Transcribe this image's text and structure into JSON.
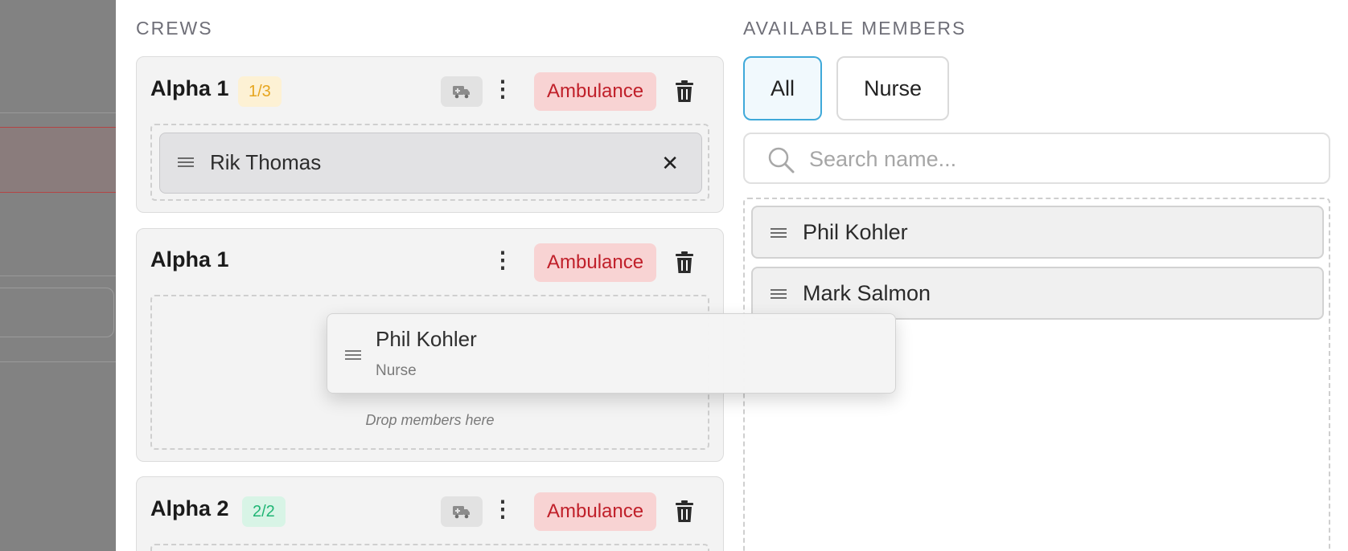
{
  "crews_title": "CREWS",
  "available_title": "AVAILABLE MEMBERS",
  "crews": [
    {
      "name": "Alpha 1",
      "count": "1/3",
      "type": "Ambulance",
      "members": [
        "Rik Thomas"
      ]
    },
    {
      "name": "Alpha 1",
      "type": "Ambulance",
      "drop_hint": "Drop members here"
    },
    {
      "name": "Alpha 2",
      "count": "2/2",
      "type": "Ambulance"
    }
  ],
  "filters": [
    "All",
    "Nurse"
  ],
  "active_filter": "All",
  "search": {
    "placeholder": "Search name..."
  },
  "available_members": [
    "Phil Kohler",
    "Mark Salmon"
  ],
  "dragging": {
    "name": "Phil Kohler",
    "role": "Nurse"
  },
  "icons": [
    "ambulance-icon",
    "more-vertical-icon",
    "trash-icon",
    "drag-handle-icon",
    "close-icon",
    "search-icon"
  ],
  "colors": {
    "type_pill_bg": "#f8d3d3",
    "type_pill_text": "#c0202a",
    "badge_partial": "#e6a51e",
    "badge_full": "#1fb574",
    "active_filter_border": "#3fa9d9"
  }
}
